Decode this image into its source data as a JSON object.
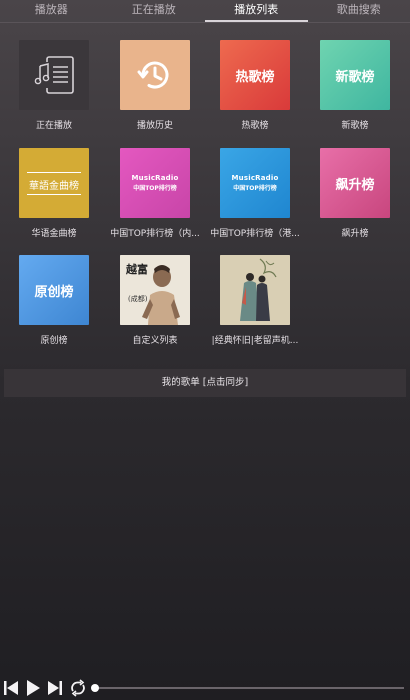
{
  "tabs": [
    "播放器",
    "正在播放",
    "播放列表",
    "歌曲搜索"
  ],
  "active_tab": 2,
  "tiles": [
    {
      "label": "正在播放",
      "cover_icon": "playlist-note-icon"
    },
    {
      "label": "播放历史",
      "cover_icon": "history-clock-icon"
    },
    {
      "label": "热歌榜",
      "cover_text": "热歌榜"
    },
    {
      "label": "新歌榜",
      "cover_text": "新歌榜"
    },
    {
      "label": "华语金曲榜",
      "cover_text": "華語金曲榜"
    },
    {
      "label": "中国TOP排行榜（内...",
      "cover_brand": "MusicRadio",
      "cover_sub": "中国TOP排行榜"
    },
    {
      "label": "中国TOP排行榜（港...",
      "cover_brand": "MusicRadio",
      "cover_sub": "中国TOP排行榜"
    },
    {
      "label": "飙升榜",
      "cover_text": "飙升榜"
    },
    {
      "label": "原创榜",
      "cover_text": "原创榜"
    },
    {
      "label": "自定义列表",
      "cover_icon": "album-art-person-icon",
      "cover_art_text": "越富"
    },
    {
      "label": "|经典怀旧|老留声机...",
      "cover_icon": "album-art-painting-icon"
    }
  ],
  "my_playlist": "我的歌单 [点击同步]",
  "colors": {
    "tile_history": "#e9b48c",
    "tile_hot": "#e24a3f",
    "tile_new": "#4fc4a6",
    "tile_gold": "#d4ab35",
    "tile_mr_pink": "#d94fb6",
    "tile_mr_blue": "#2b97dc",
    "tile_rise": "#d2568c",
    "tile_original": "#4f9be0"
  },
  "player": {
    "progress": 0.0
  }
}
